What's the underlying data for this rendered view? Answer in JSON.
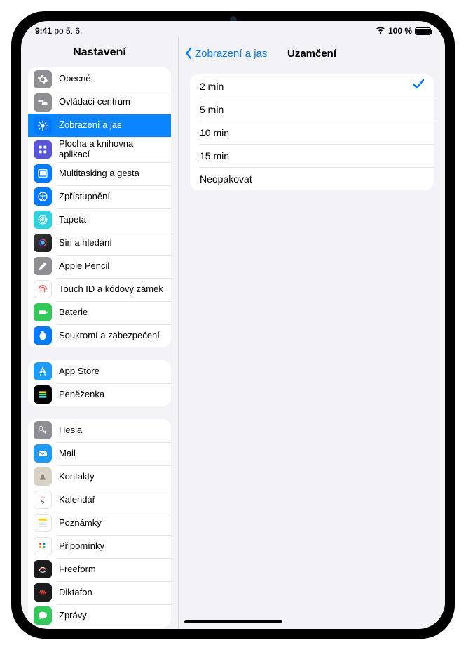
{
  "status": {
    "time": "9:41",
    "date": "po 5. 6.",
    "batteryText": "100 %"
  },
  "sidebar": {
    "title": "Nastavení",
    "groups": [
      [
        {
          "id": "general",
          "label": "Obecné"
        },
        {
          "id": "control",
          "label": "Ovládací centrum"
        },
        {
          "id": "display",
          "label": "Zobrazení a jas",
          "selected": true
        },
        {
          "id": "home",
          "label": "Plocha a knihovna aplikací"
        },
        {
          "id": "multi",
          "label": "Multitasking a gesta"
        },
        {
          "id": "access",
          "label": "Zpřístupnění"
        },
        {
          "id": "wall",
          "label": "Tapeta"
        },
        {
          "id": "siri",
          "label": "Siri a hledání"
        },
        {
          "id": "pencil",
          "label": "Apple Pencil"
        },
        {
          "id": "touch",
          "label": "Touch ID a kódový zámek"
        },
        {
          "id": "battery",
          "label": "Baterie"
        },
        {
          "id": "privacy",
          "label": "Soukromí a zabezpečení"
        }
      ],
      [
        {
          "id": "store",
          "label": "App Store"
        },
        {
          "id": "wallet",
          "label": "Peněženka"
        }
      ],
      [
        {
          "id": "pwd",
          "label": "Hesla"
        },
        {
          "id": "mail",
          "label": "Mail"
        },
        {
          "id": "contacts",
          "label": "Kontakty"
        },
        {
          "id": "cal",
          "label": "Kalendář"
        },
        {
          "id": "notes",
          "label": "Poznámky"
        },
        {
          "id": "rem",
          "label": "Připomínky"
        },
        {
          "id": "free",
          "label": "Freeform"
        },
        {
          "id": "dik",
          "label": "Diktafon"
        },
        {
          "id": "msg",
          "label": "Zprávy"
        }
      ]
    ]
  },
  "content": {
    "backLabel": "Zobrazení a jas",
    "title": "Uzamčení",
    "options": [
      {
        "label": "2 min",
        "selected": true
      },
      {
        "label": "5 min",
        "selected": false
      },
      {
        "label": "10 min",
        "selected": false
      },
      {
        "label": "15 min",
        "selected": false
      },
      {
        "label": "Neopakovat",
        "selected": false
      }
    ]
  }
}
